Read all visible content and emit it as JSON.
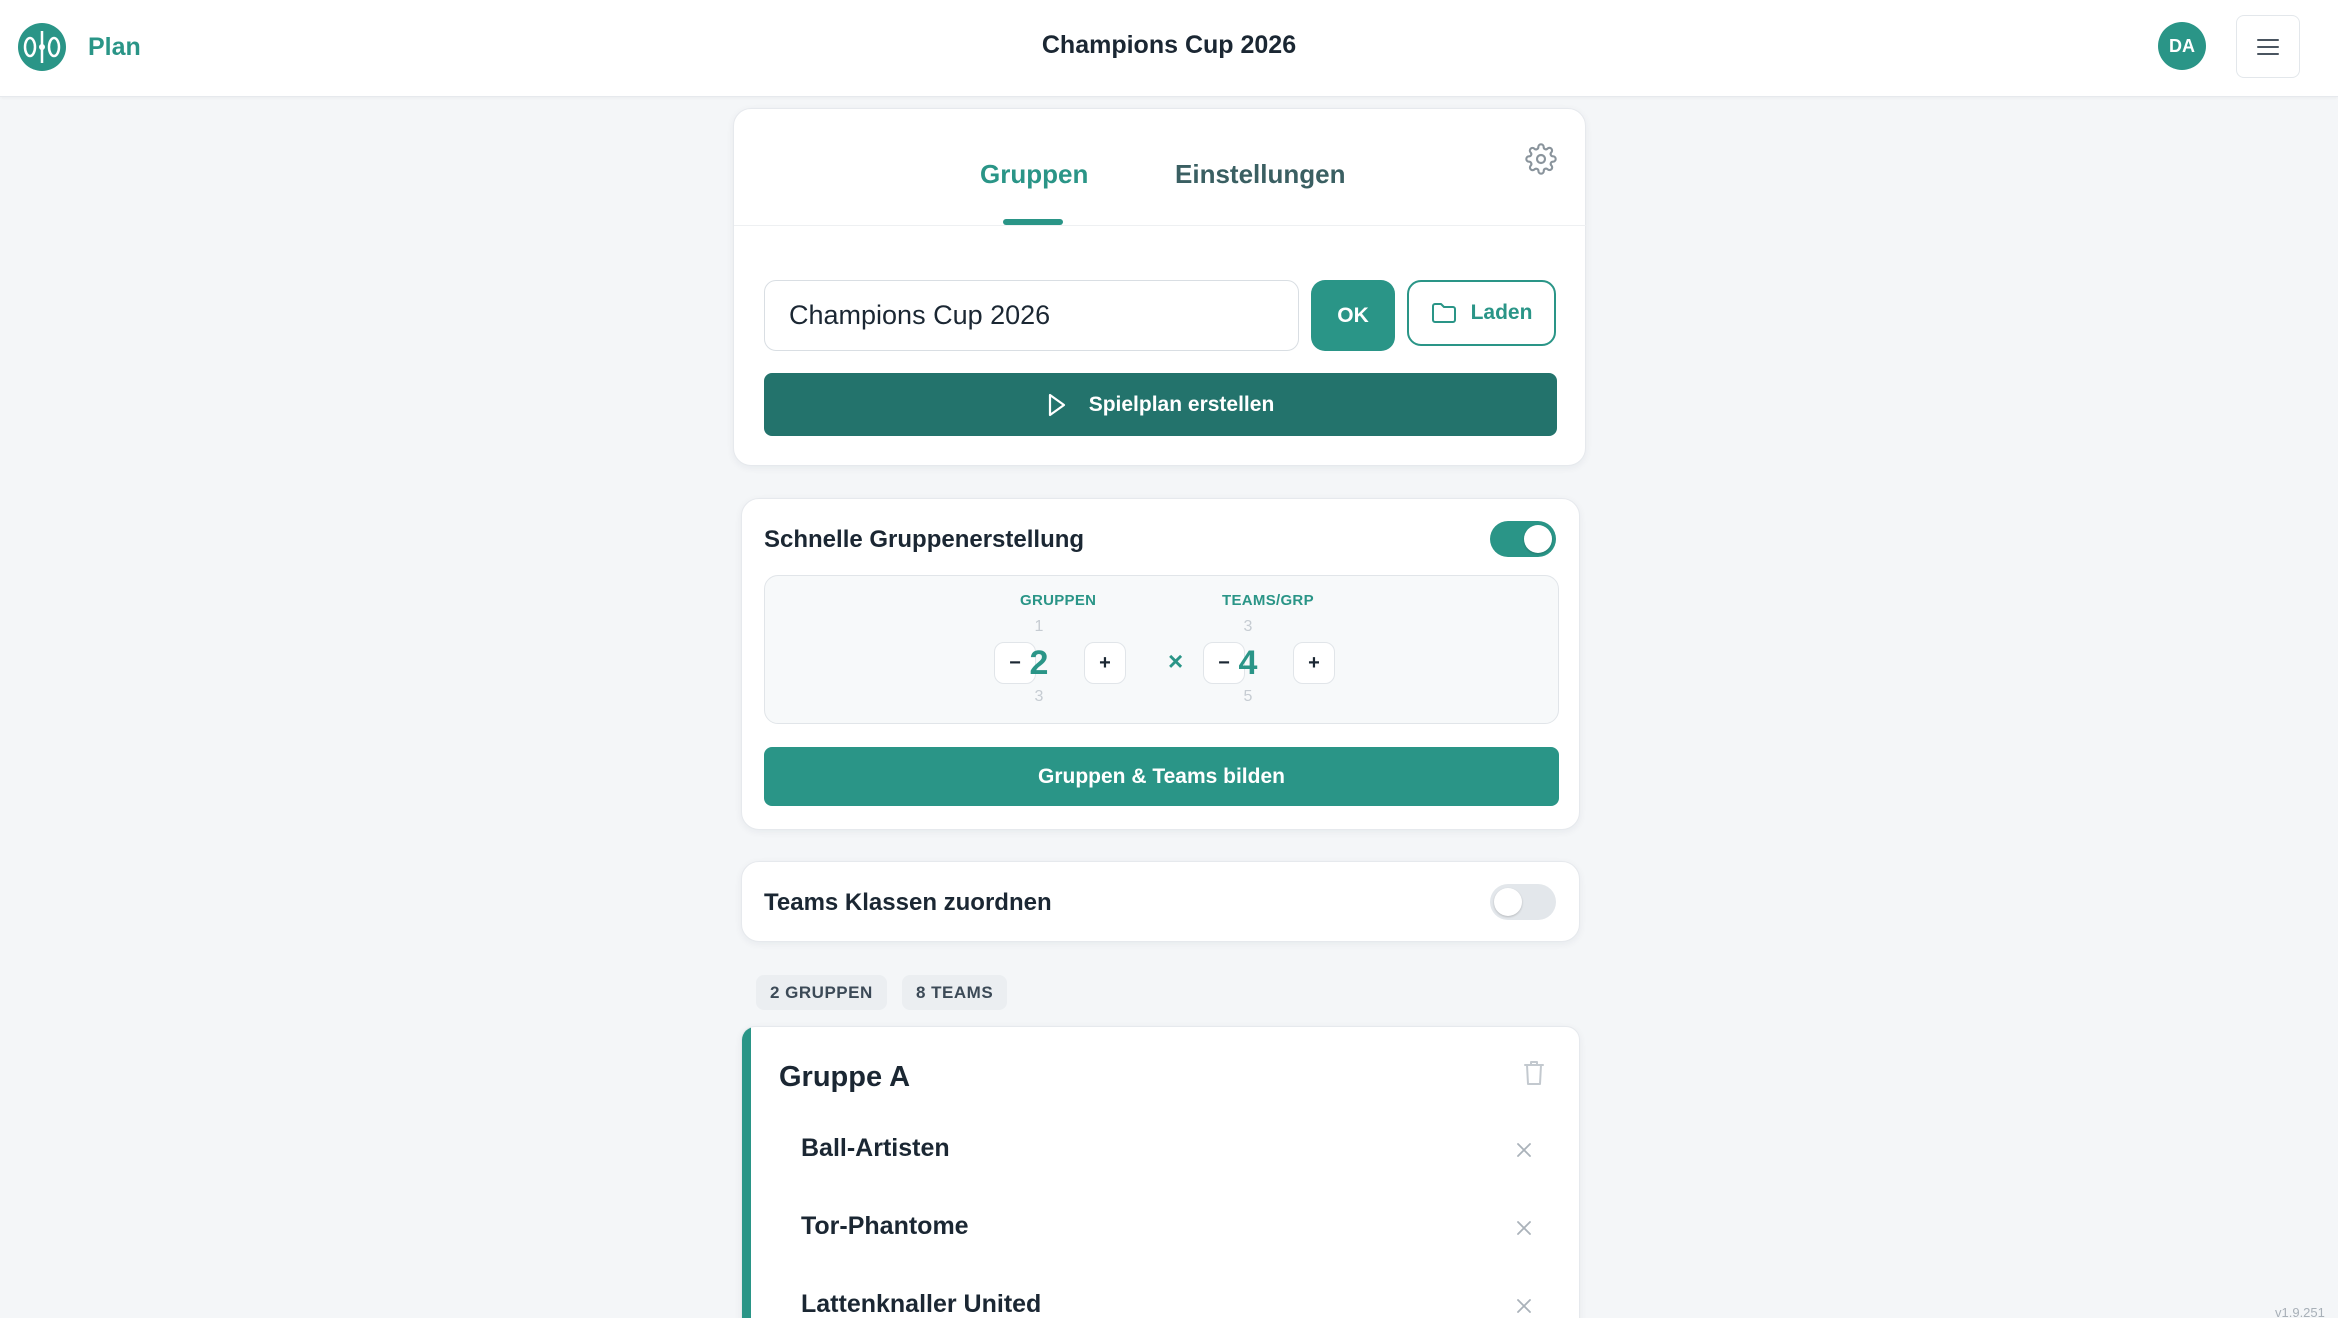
{
  "header": {
    "brand": "Plan",
    "title": "Champions Cup 2026",
    "avatar_initials": "DA",
    "icons": {
      "logo": "soccer-field-logo-icon",
      "menu": "hamburger-menu-icon"
    }
  },
  "tabs": [
    {
      "label": "Gruppen",
      "active": true
    },
    {
      "label": "Einstellungen",
      "active": false
    }
  ],
  "tournament": {
    "name_value": "Champions Cup 2026",
    "ok_label": "OK",
    "load_label": "Laden",
    "create_label": "Spielplan erstellen"
  },
  "quick_create": {
    "label": "Schnelle Gruppenerstellung",
    "enabled": true,
    "groups": {
      "label": "GRUPPEN",
      "prev": "1",
      "value": "2",
      "next": "3"
    },
    "teams_per_group": {
      "label": "TEAMS/GRP",
      "prev": "3",
      "value": "4",
      "next": "5"
    },
    "minus": "−",
    "plus": "+",
    "times": "×",
    "build_label": "Gruppen & Teams bilden"
  },
  "classes": {
    "label": "Teams Klassen zuordnen",
    "enabled": false
  },
  "summary": {
    "groups_badge": "2 GRUPPEN",
    "teams_badge": "8 TEAMS"
  },
  "group_a": {
    "title": "Gruppe A",
    "teams": [
      "Ball-Artisten",
      "Tor-Phantome",
      "Lattenknaller United"
    ]
  },
  "version": "v1.9.251",
  "colors": {
    "accent": "#2a9587",
    "accent_dark": "#23736c",
    "background": "#f4f6f8"
  }
}
